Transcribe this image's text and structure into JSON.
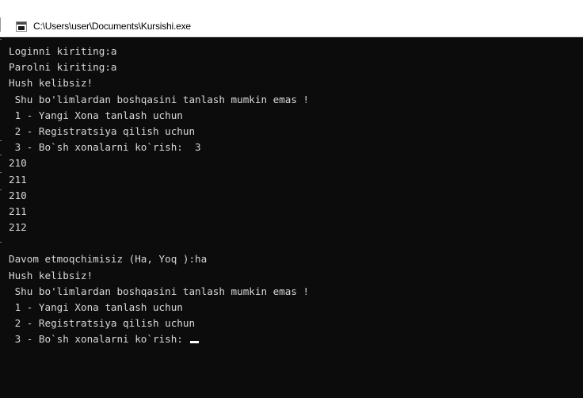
{
  "window": {
    "title": "C:\\Users\\user\\Documents\\Kursishi.exe",
    "icon": "console-app-icon"
  },
  "console": {
    "lines": [
      "Loginni kiriting:a",
      "Parolni kiriting:a",
      "Hush kelibsiz!",
      " Shu bo'limlardan boshqasini tanlash mumkin emas !",
      " 1 - Yangi Xona tanlash uchun",
      " 2 - Registratsiya qilish uchun",
      " 3 - Bo`sh xonalarni ko`rish:  3",
      "210",
      "211",
      "210",
      "211",
      "212",
      "",
      "Davom etmoqchimisiz (Ha, Yoq ):ha",
      "Hush kelibsiz!",
      " Shu bo'limlardan boshqasini tanlash mumkin emas !",
      " 1 - Yangi Xona tanlash uchun",
      " 2 - Registratsiya qilish uchun",
      " 3 - Bo`sh xonalarni ko`rish: "
    ]
  }
}
